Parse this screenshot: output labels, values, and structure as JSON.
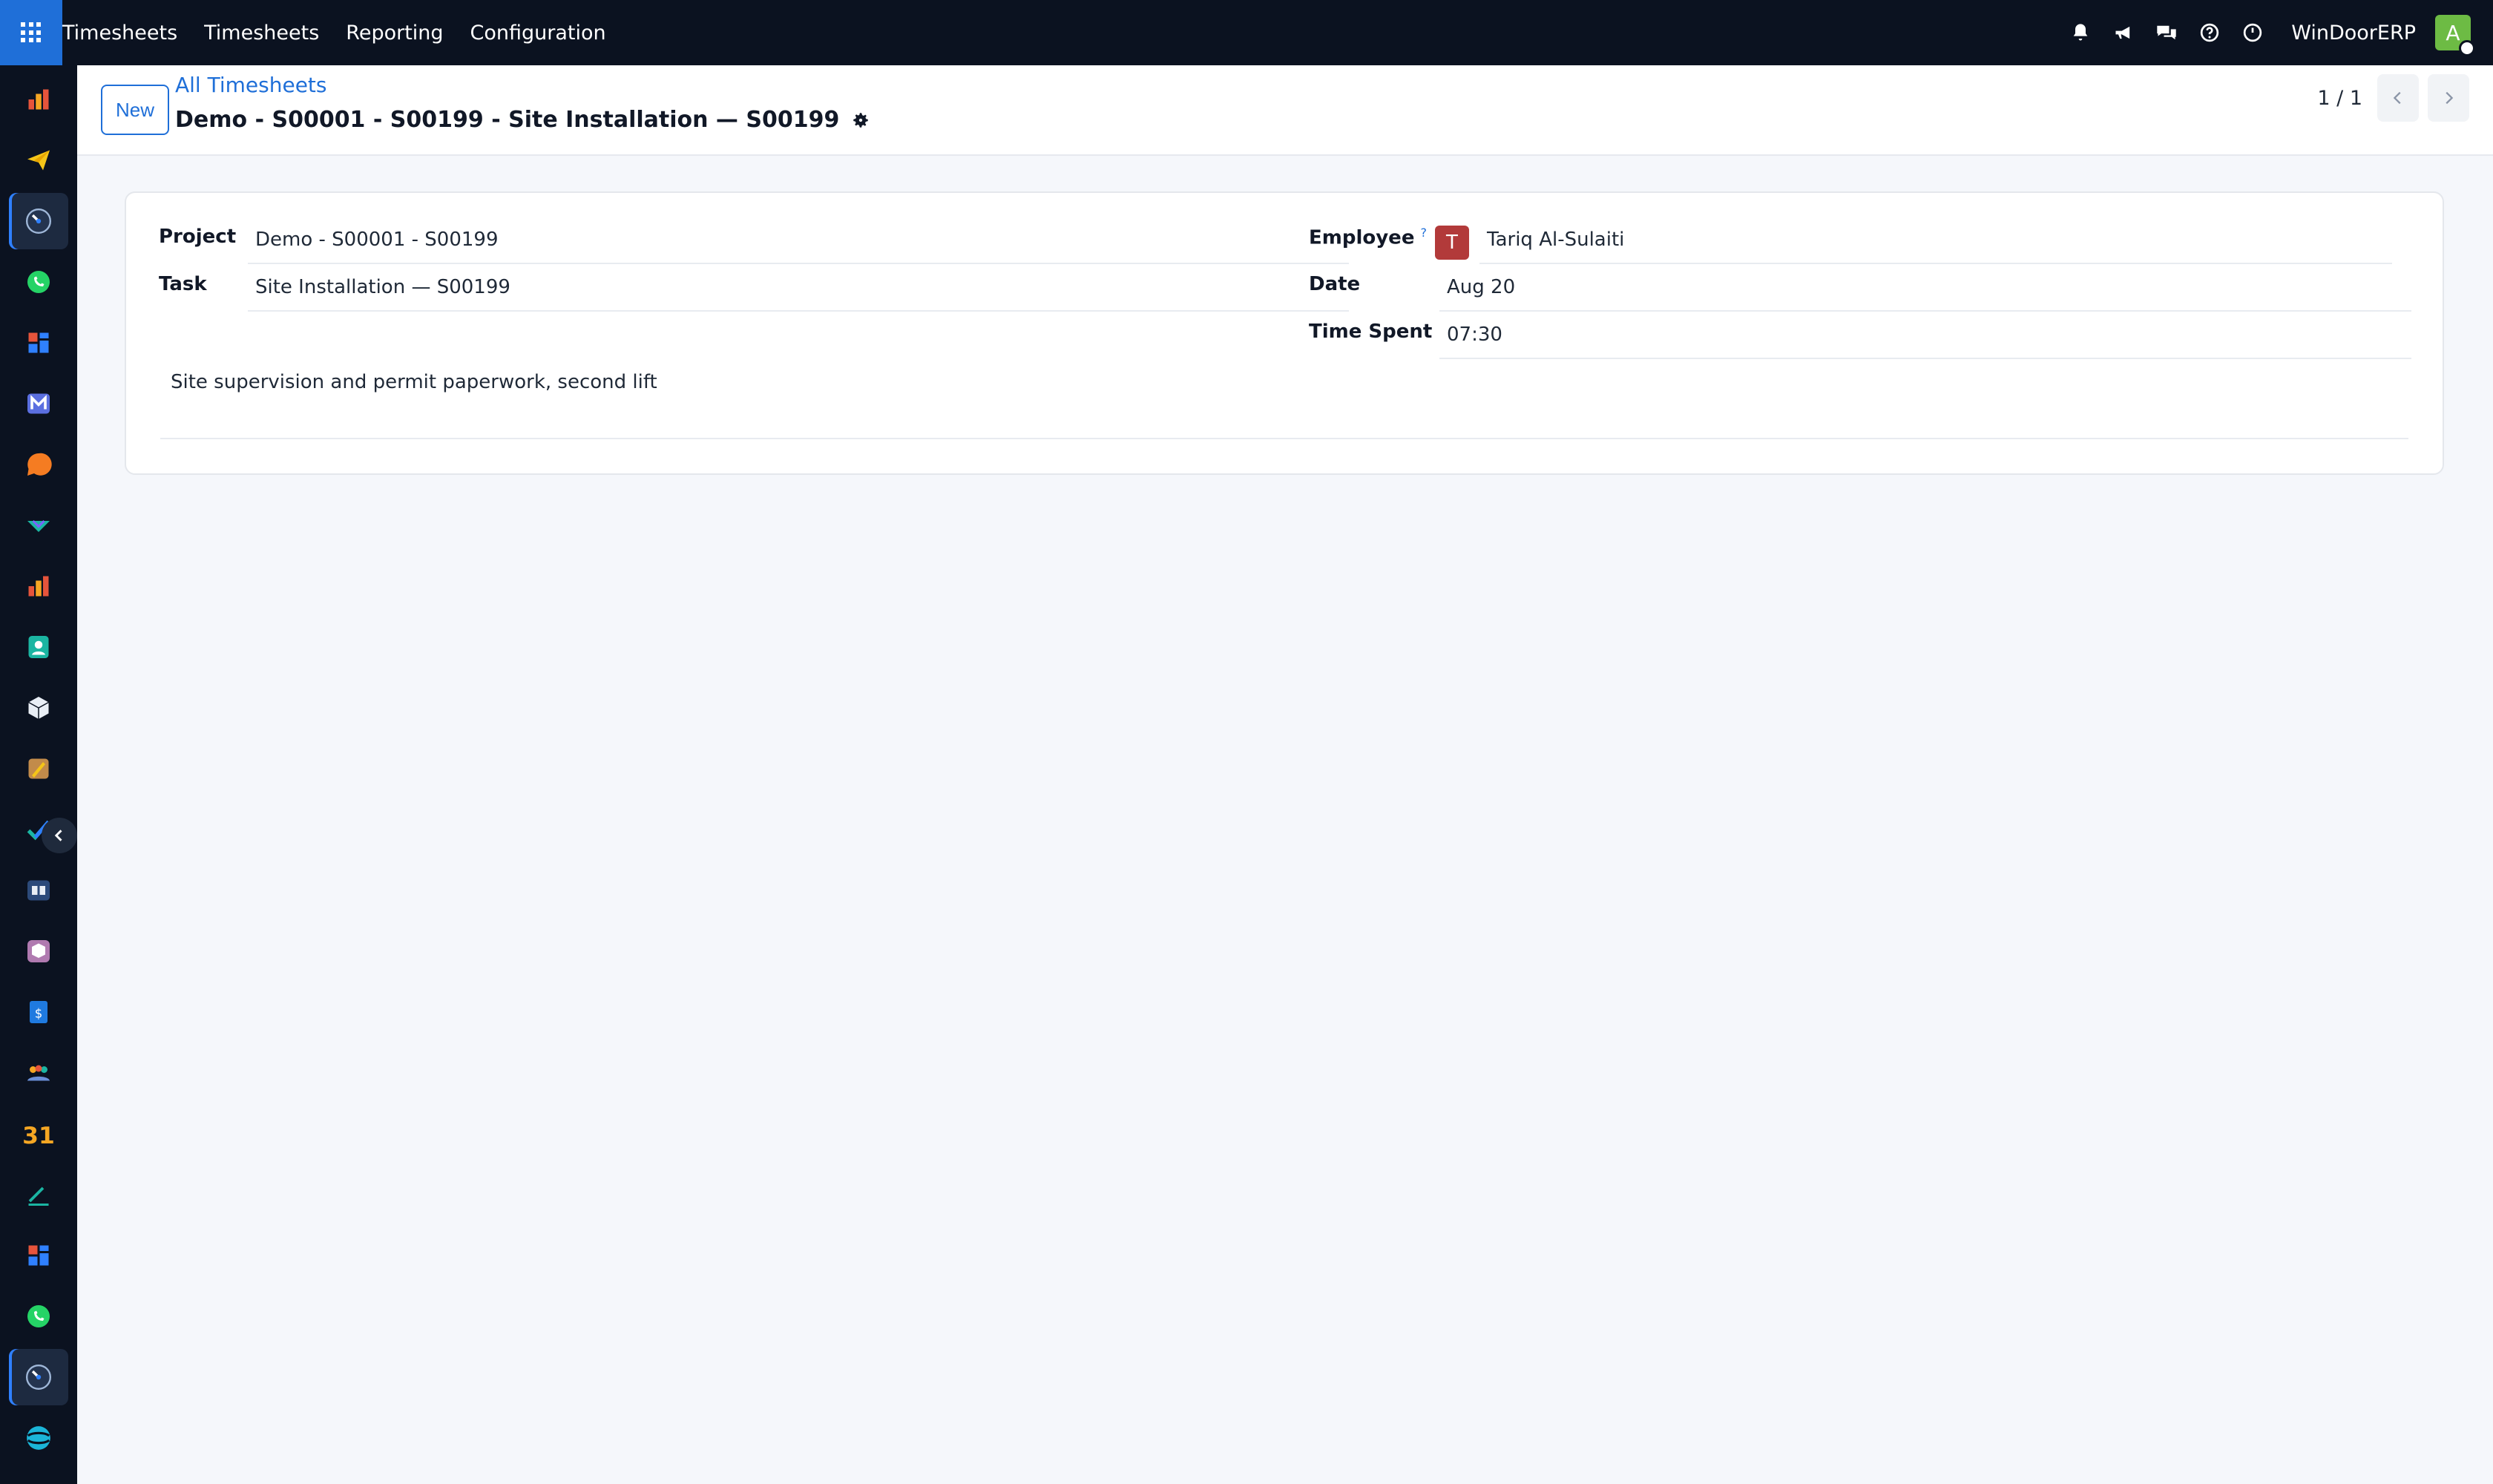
{
  "topbar": {
    "menu": [
      "Timesheets",
      "Timesheets",
      "Reporting",
      "Configuration"
    ],
    "company": "WinDoorERP",
    "user_initial": "A",
    "icons": [
      "bell-icon",
      "megaphone-icon",
      "chat-icon",
      "help-icon",
      "clock-icon"
    ]
  },
  "sidebar": {
    "apps": [
      "dashboard-icon",
      "paper-plane-icon",
      "timer-icon",
      "whatsapp-icon",
      "grid-apps-icon",
      "mail-icon",
      "chat-bubble-icon",
      "checkmark-icon",
      "bar-chart-icon",
      "contacts-icon",
      "cube-icon",
      "palette-icon",
      "todo-check-icon",
      "knowledge-icon",
      "box-icon",
      "invoice-icon",
      "team-icon",
      "calendar-icon",
      "sign-icon",
      "grid-apps-icon",
      "whatsapp-icon",
      "timer-icon",
      "discuss-icon"
    ],
    "active_indexes": [
      2,
      21
    ]
  },
  "control": {
    "new_label": "New",
    "breadcrumb": "All Timesheets",
    "title": "Demo - S00001 - S00199 - Site Installation — S00199",
    "pager": "1 / 1"
  },
  "form": {
    "project_label": "Project",
    "project_value": "Demo - S00001 - S00199",
    "task_label": "Task",
    "task_value": "Site Installation — S00199",
    "employee_label": "Employee",
    "employee_help": "?",
    "employee_initial": "T",
    "employee_value": "Tariq Al-Sulaiti",
    "date_label": "Date",
    "date_value": "Aug 20",
    "time_label": "Time Spent",
    "time_value": "07:30",
    "description": "Site supervision and permit paperwork, second lift"
  },
  "colors": {
    "topbar": "#0b1220",
    "accent": "#1f6fd8",
    "employee_avatar": "#b23a3a",
    "user_avatar": "#6dbb44"
  }
}
